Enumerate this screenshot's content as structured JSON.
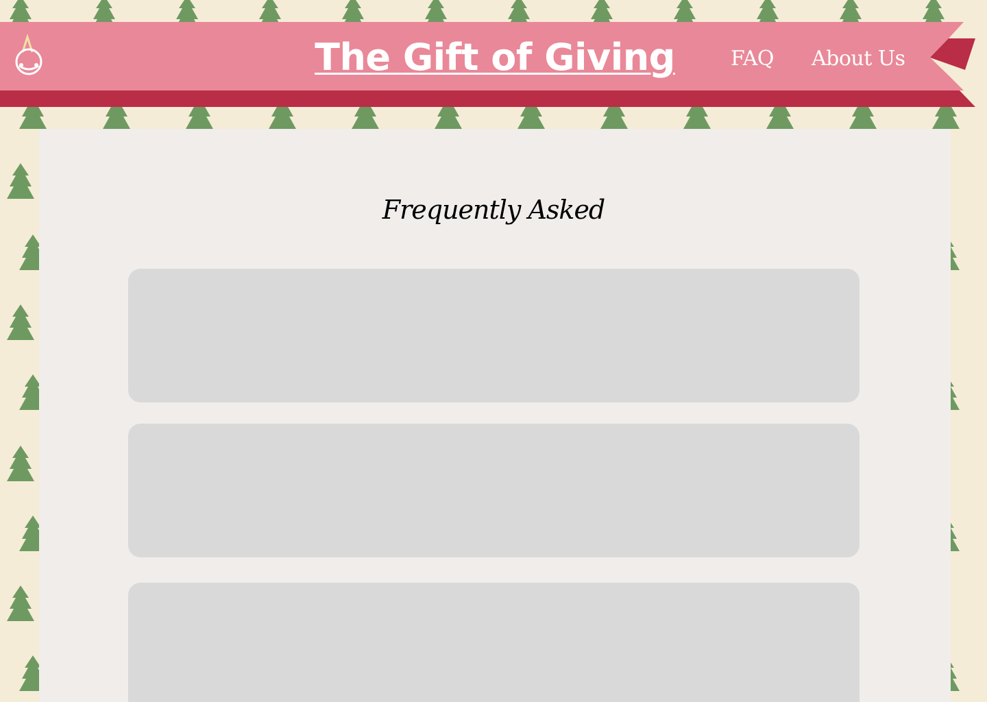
{
  "header": {
    "logo_icon": "gift-bag-icon",
    "title": "The Gift of Giving",
    "nav": [
      {
        "label": "FAQ"
      },
      {
        "label": "About Us"
      }
    ]
  },
  "faq_section": {
    "heading": "Frequently Asked",
    "cards": [
      {
        "question": ""
      },
      {
        "question": ""
      },
      {
        "question": ""
      }
    ]
  },
  "colors": {
    "page_background": "#f5ecd7",
    "tree_green": "#6e9a62",
    "banner_pink": "#e98898",
    "banner_dark_red": "#b92d46",
    "panel_background": "#f0edeb",
    "card_gray": "#d9d9d9",
    "text_white": "#ffffff"
  }
}
